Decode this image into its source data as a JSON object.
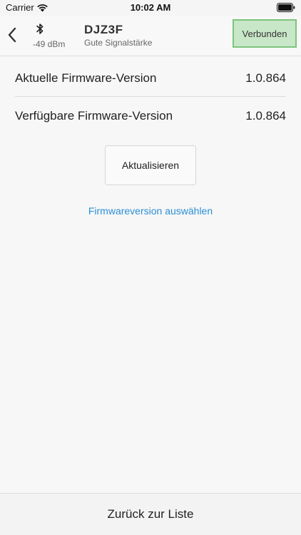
{
  "status_bar": {
    "carrier": "Carrier",
    "time": "10:02 AM"
  },
  "header": {
    "back_icon": "chevron-left-icon",
    "bluetooth_icon": "bluetooth-icon",
    "rssi": "-49 dBm",
    "device_name": "DJZ3F",
    "signal_quality": "Gute Signalstärke",
    "connection_status": "Verbunden"
  },
  "firmware": {
    "current_label": "Aktuelle Firmware-Version",
    "current_value": "1.0.864",
    "available_label": "Verfügbare Firmware-Version",
    "available_value": "1.0.864"
  },
  "actions": {
    "update_label": "Aktualisieren",
    "select_version_label": "Firmwareversion auswählen"
  },
  "footer": {
    "back_to_list_label": "Zurück zur Liste"
  },
  "colors": {
    "badge_bg": "#c8e7c8",
    "badge_border": "#7cc47c",
    "link": "#2b8fd6",
    "background": "#f7f7f7"
  }
}
